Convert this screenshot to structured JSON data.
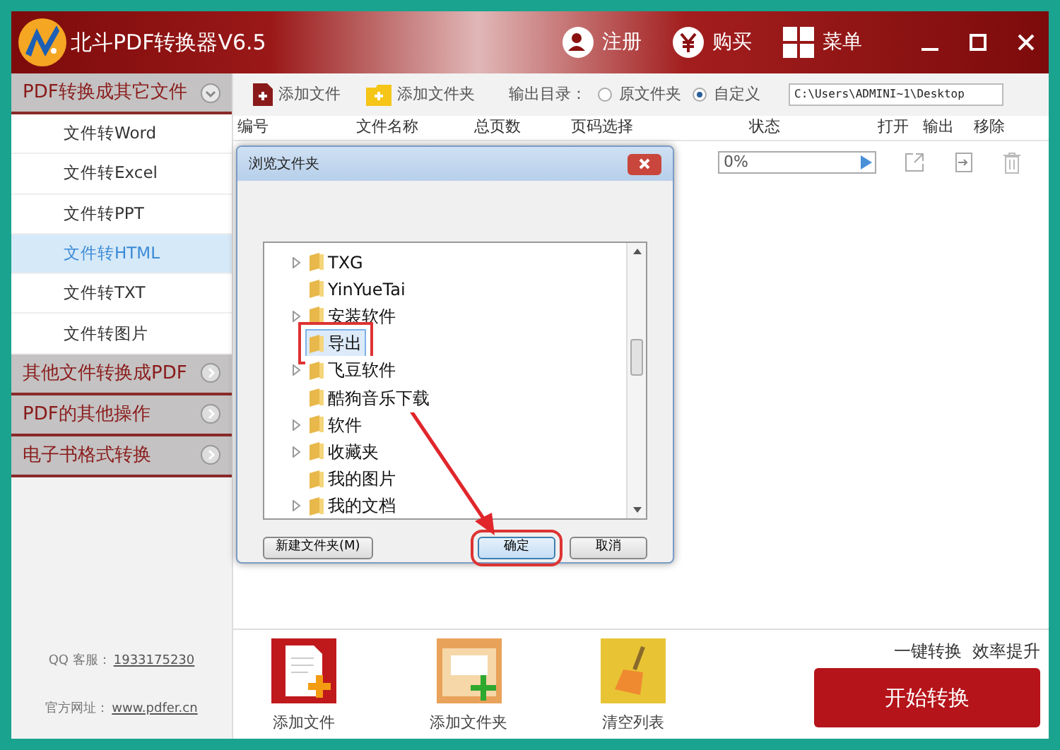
{
  "window": {
    "title": "北斗PDF转换器V6.5",
    "actions": [
      {
        "kind": "user",
        "label": "注册"
      },
      {
        "kind": "buy",
        "label": "购买"
      },
      {
        "kind": "menu",
        "label": "菜单"
      }
    ]
  },
  "sidebar": {
    "sections": [
      {
        "label": "PDF转换成其它文件",
        "expanded": true,
        "items": [
          {
            "label": "文件转Word",
            "selected": false
          },
          {
            "label": "文件转Excel",
            "selected": false
          },
          {
            "label": "文件转PPT",
            "selected": false
          },
          {
            "label": "文件转HTML",
            "selected": true
          },
          {
            "label": "文件转TXT",
            "selected": false
          },
          {
            "label": "文件转图片",
            "selected": false
          }
        ]
      },
      {
        "label": "其他文件转换成PDF",
        "expanded": false
      },
      {
        "label": "PDF的其他操作",
        "expanded": false
      },
      {
        "label": "电子书格式转换",
        "expanded": false
      }
    ],
    "qq_label": "QQ 客服：",
    "qq": "1933175230",
    "site_label": "官方网址：",
    "site": "www.pdfer.cn"
  },
  "toolbar": {
    "add_file": "添加文件",
    "add_folder": "添加文件夹",
    "output_label": "输出目录：",
    "options": [
      {
        "label": "原文件夹",
        "selected": false
      },
      {
        "label": "自定义",
        "selected": true
      }
    ],
    "path": "C:\\Users\\ADMINI~1\\Desktop"
  },
  "table": {
    "columns": [
      "编号",
      "文件名称",
      "总页数",
      "页码选择",
      "状态",
      "打开",
      "输出",
      "移除"
    ],
    "rows": [
      {
        "status": "0%",
        "level": 0
      }
    ]
  },
  "dialog": {
    "title": "浏览文件夹",
    "tree": [
      {
        "label": "TXG",
        "expandable": true,
        "selected": false
      },
      {
        "label": "YinYueTai",
        "expandable": false,
        "selected": false
      },
      {
        "label": "安装软件",
        "expandable": true,
        "selected": false
      },
      {
        "label": "导出",
        "expandable": false,
        "selected": true
      },
      {
        "label": "飞豆软件",
        "expandable": true,
        "selected": false
      },
      {
        "label": "酷狗音乐下载",
        "expandable": false,
        "selected": false
      },
      {
        "label": "软件",
        "expandable": true,
        "selected": false
      },
      {
        "label": "收藏夹",
        "expandable": true,
        "selected": false
      },
      {
        "label": "我的图片",
        "expandable": false,
        "selected": false
      },
      {
        "label": "我的文档",
        "expandable": true,
        "selected": false
      }
    ],
    "new_folder": "新建文件夹(M)",
    "ok": "确定",
    "cancel": "取消"
  },
  "bottom": {
    "actions": [
      {
        "kind": "file",
        "label": "添加文件"
      },
      {
        "kind": "folder",
        "label": "添加文件夹"
      },
      {
        "kind": "clear",
        "label": "清空列表"
      }
    ],
    "slogan": "一键转换  效率提升",
    "start": "开始转换"
  }
}
